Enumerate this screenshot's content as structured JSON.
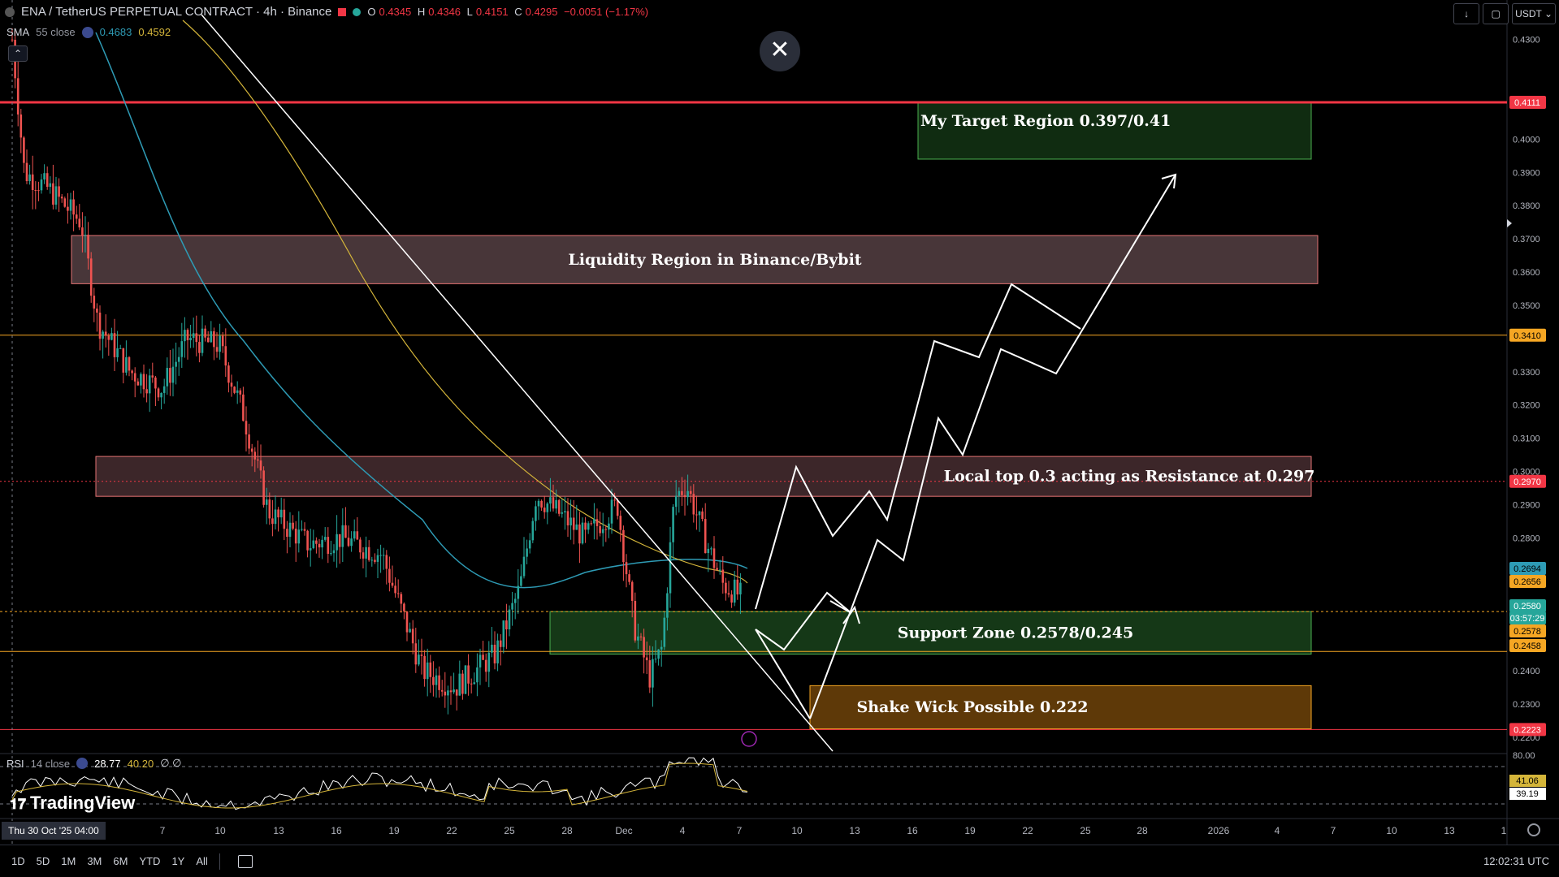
{
  "header": {
    "symbol": "ENA / TetherUS PERPETUAL CONTRACT · 4h · Binance",
    "open_label": "O",
    "open": "0.4345",
    "high_label": "H",
    "high": "0.4346",
    "low_label": "L",
    "low": "0.4151",
    "close_label": "C",
    "close": "0.4295",
    "change": "−0.0051 (−1.17%)"
  },
  "sma": {
    "label": "SMA",
    "params": "55 close",
    "value1": "0.4683",
    "value2": "0.4592"
  },
  "rsi": {
    "label": "RSI",
    "params": "14 close",
    "value1": "28.77",
    "value2": "40.20",
    "value3": "∅ ∅"
  },
  "top_right": {
    "currency": "USDT"
  },
  "colors": {
    "background": "#000000",
    "up": "#26a69a",
    "down": "#ef5350",
    "sma_blue": "#2e9bb5",
    "sma_yellow": "#d4b53a",
    "resistance_red": "#f23645",
    "orange_level": "#f5a623",
    "green_zone": "#2e7d32",
    "liquidity_zone": "#6d4c50",
    "shake_zone": "#9c5f0d"
  },
  "annotations": {
    "target": "My Target Region 0.397/0.41",
    "liquidity": "Liquidity Region in Binance/Bybit",
    "local_top": "Local  top 0.3 acting as Resistance at 0.297",
    "support": "Support Zone 0.2578/0.245",
    "shake": "Shake Wick Possible 0.222"
  },
  "chart_data": {
    "type": "candlestick",
    "y_axis_ticks": [
      "0.4300",
      "0.4000",
      "0.3900",
      "0.3800",
      "0.3700",
      "0.3600",
      "0.3500",
      "0.3300",
      "0.3200",
      "0.3100",
      "0.3000",
      "0.2900",
      "0.2800",
      "0.2400",
      "0.2300",
      "0.2200"
    ],
    "y_range": [
      0.2175,
      0.4375
    ],
    "price_labels": [
      {
        "value": "0.4111",
        "color": "#f23645"
      },
      {
        "value": "0.3410",
        "color": "#f5a623"
      },
      {
        "value": "0.2970",
        "color": "#f23645"
      },
      {
        "value": "0.2694",
        "color": "#2e9bb5"
      },
      {
        "value": "0.2656",
        "color": "#f5a623"
      },
      {
        "value": "0.2580",
        "color": "#26a69a"
      },
      {
        "value": "03:57:29",
        "color": "#26a69a"
      },
      {
        "value": "0.2578",
        "color": "#f5a623"
      },
      {
        "value": "0.2458",
        "color": "#f5a623"
      },
      {
        "value": "0.2223",
        "color": "#f23645"
      }
    ],
    "x_axis_ticks": [
      "7",
      "10",
      "13",
      "16",
      "19",
      "22",
      "25",
      "28",
      "Dec",
      "4",
      "7",
      "10",
      "13",
      "16",
      "19",
      "22",
      "25",
      "28",
      "2026",
      "4",
      "7",
      "10",
      "13",
      "1"
    ],
    "current_date_label": "Thu 30 Oct '25   04:00",
    "horizontal_levels": [
      0.4111,
      0.341,
      0.297,
      0.2578,
      0.2458,
      0.2223
    ],
    "zones": [
      {
        "name": "target",
        "from": 0.394,
        "to": 0.411
      },
      {
        "name": "liquidity",
        "from": 0.3565,
        "to": 0.371
      },
      {
        "name": "local_top",
        "from": 0.2925,
        "to": 0.3045
      },
      {
        "name": "support",
        "from": 0.245,
        "to": 0.2578
      },
      {
        "name": "shake",
        "from": 0.2225,
        "to": 0.2355
      }
    ],
    "rsi_axis": [
      "80.00",
      "41.06",
      "39.19"
    ]
  },
  "bottom_bar": {
    "ranges": [
      "1D",
      "5D",
      "1M",
      "3M",
      "6M",
      "YTD",
      "1Y",
      "All"
    ],
    "clock": "12:02:31 UTC"
  },
  "logo": "TradingView"
}
